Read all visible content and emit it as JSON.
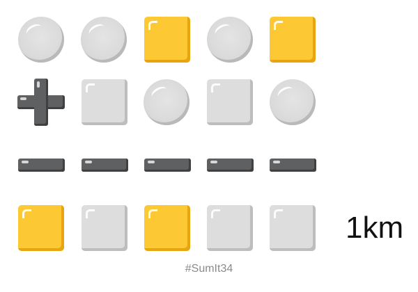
{
  "puzzle": {
    "rows": [
      [
        "grey-circle",
        "grey-circle",
        "yellow-square",
        "grey-circle",
        "yellow-square"
      ],
      [
        "plus",
        "grey-square",
        "grey-circle",
        "grey-square",
        "grey-circle"
      ],
      [
        "minus",
        "minus",
        "minus",
        "minus",
        "minus"
      ],
      [
        "yellow-square",
        "grey-square",
        "yellow-square",
        "grey-square",
        "grey-square"
      ]
    ],
    "colors": {
      "yellow": "#fcc934",
      "grey": "#dddddd",
      "operator": "#5f6062"
    },
    "result_text": "1km",
    "hashtag": "#SumIt34"
  }
}
